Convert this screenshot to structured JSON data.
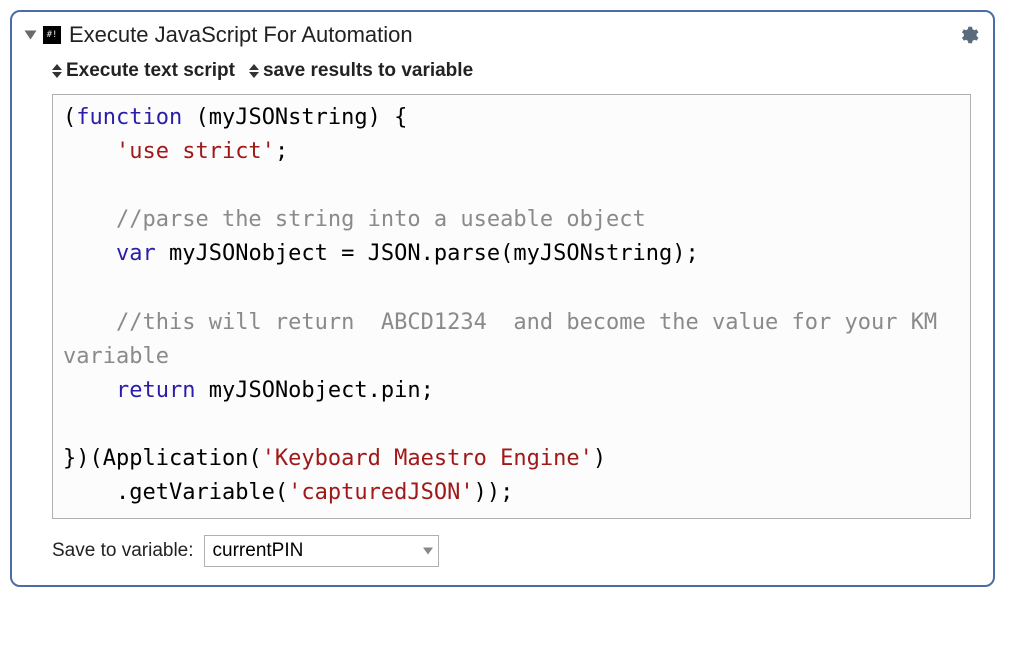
{
  "header": {
    "title": "Execute JavaScript For Automation"
  },
  "options": {
    "mode_label": "Execute text script",
    "output_label": "save results to variable"
  },
  "code": {
    "l1a": "(",
    "l1b": "function",
    "l1c": " (myJSONstring) {",
    "l2": "'use strict'",
    "l2p": ";",
    "l4": "//parse the string into a useable object",
    "l5a": "var",
    "l5b": " myJSONobject = JSON.parse(myJSONstring);",
    "l7": "//this will return  ABCD1234  and become the value for your KM variable",
    "l8a": "return",
    "l8b": " myJSONobject.pin;",
    "l10": "})(Application(",
    "l10s": "'Keyboard Maestro Engine'",
    "l10e": ")",
    "l11": "    .getVariable(",
    "l11s": "'capturedJSON'",
    "l11e": "));"
  },
  "footer": {
    "save_label": "Save to variable:",
    "variable_name": "currentPIN"
  }
}
